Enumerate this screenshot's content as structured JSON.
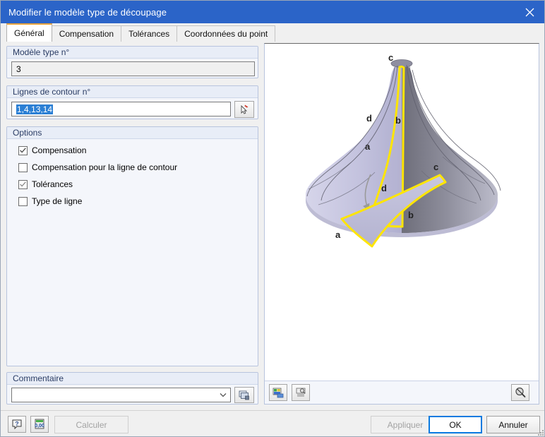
{
  "window": {
    "title": "Modifier le modèle type de découpage",
    "close_icon": "close-icon",
    "titlebar_color": "#2b64c8"
  },
  "tabs": [
    {
      "label": "Général",
      "active": true
    },
    {
      "label": "Compensation",
      "active": false
    },
    {
      "label": "Tolérances",
      "active": false
    },
    {
      "label": "Coordonnées du point",
      "active": false
    }
  ],
  "form": {
    "model_group": {
      "title": "Modèle type n°",
      "value": "3"
    },
    "contour_group": {
      "title": "Lignes de contour n°",
      "value": "1,4,13,14",
      "pick_button_icon": "pick-cursor-icon"
    },
    "options_group": {
      "title": "Options",
      "items": [
        {
          "label": "Compensation",
          "checked": true
        },
        {
          "label": "Compensation pour la ligne de contour",
          "checked": false
        },
        {
          "label": "Tolérances",
          "checked": true
        },
        {
          "label": "Type de ligne",
          "checked": false
        }
      ]
    },
    "comment_group": {
      "title": "Commentaire",
      "value": "",
      "dropdown_icon": "chevron-down-icon",
      "library_button_icon": "copy-windows-icon"
    }
  },
  "graphic": {
    "labels_3d": [
      "c",
      "d",
      "b",
      "a"
    ],
    "labels_flat": [
      "c",
      "d",
      "b",
      "a"
    ],
    "surface_fill_light": "#c3c2de",
    "surface_fill_dark": "#8d8d99",
    "highlight_color": "#ffe500",
    "toolbar": [
      {
        "name": "export-image-button",
        "icon": "image-export-icon"
      },
      {
        "name": "print-preview-button",
        "icon": "print-preview-icon"
      },
      {
        "name": "zoom-reset-button",
        "icon": "magnifier-cancel-icon"
      }
    ]
  },
  "footer": {
    "help_icon": "help-bubble-icon",
    "units_icon": "units-calculator-icon",
    "calculate_label": "Calculer",
    "apply_label": "Appliquer",
    "ok_label": "OK",
    "cancel_label": "Annuler"
  }
}
